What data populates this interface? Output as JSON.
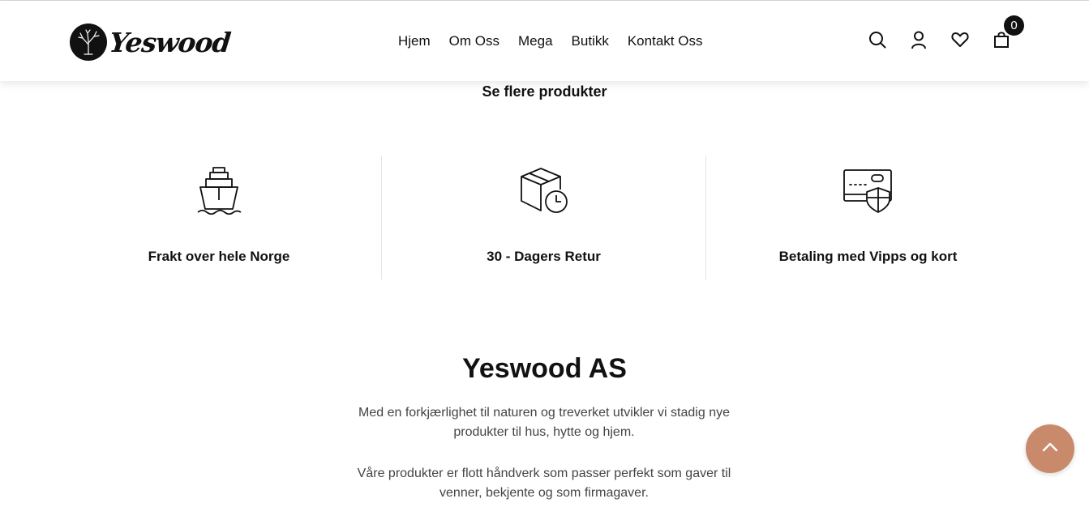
{
  "header": {
    "logo_text": "Yeswood",
    "nav": [
      {
        "label": "Hjem"
      },
      {
        "label": "Om Oss"
      },
      {
        "label": "Mega"
      },
      {
        "label": "Butikk"
      },
      {
        "label": "Kontakt Oss"
      }
    ],
    "icons": [
      "search-icon",
      "user-icon",
      "heart-icon",
      "bag-icon"
    ],
    "cart_count": "0"
  },
  "see_more": "Se flere produkter",
  "features": [
    {
      "icon": "ship-icon",
      "label": "Frakt over hele Norge"
    },
    {
      "icon": "box-clock-icon",
      "label": "30 - Dagers Retur"
    },
    {
      "icon": "card-shield-icon",
      "label": "Betaling med Vipps og kort"
    }
  ],
  "about": {
    "title": "Yeswood AS",
    "paragraph1": "Med en forkjærlighet til naturen og treverket utvikler vi stadig nye produkter til hus, hytte og hjem.",
    "paragraph2": "Våre produkter er flott håndverk  som passer perfekt som gaver til venner, bekjente og som firmagaver."
  },
  "colors": {
    "accent": "#c98a6c",
    "text": "#111111",
    "muted": "#444444"
  }
}
